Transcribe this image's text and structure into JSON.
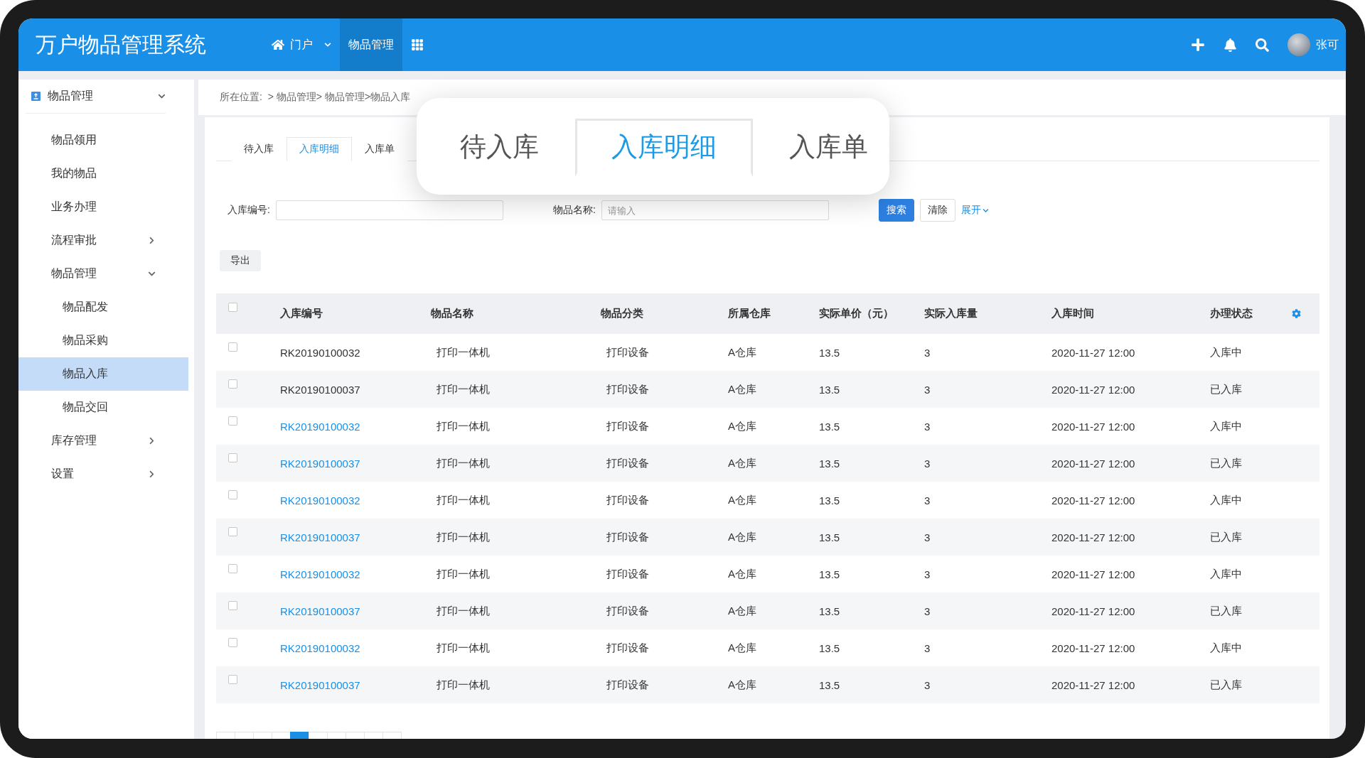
{
  "header": {
    "title": "万户物品管理系统",
    "nav": [
      {
        "kind": "home",
        "label": "门户",
        "selected": false
      },
      {
        "kind": "text",
        "label": "物品管理",
        "selected": true
      },
      {
        "kind": "apps",
        "selected": false
      }
    ],
    "user": {
      "name": "张可"
    }
  },
  "sidebar": {
    "module": {
      "label": "物品管理",
      "expanded": true
    },
    "items": [
      {
        "label": "物品领用",
        "selected": false
      },
      {
        "label": "我的物品",
        "selected": false
      },
      {
        "label": "业务办理",
        "selected": false
      },
      {
        "label": "流程审批",
        "selected": false,
        "expanded": false
      },
      {
        "label": "物品管理",
        "selected": false,
        "expanded": true,
        "children": [
          {
            "label": "物品配发",
            "selected": false
          },
          {
            "label": "物品采购",
            "selected": false
          },
          {
            "label": "物品入库",
            "selected": true
          },
          {
            "label": "物品交回",
            "selected": false
          }
        ]
      },
      {
        "label": "库存管理",
        "selected": false,
        "expanded": false
      },
      {
        "label": "设置",
        "selected": false,
        "expanded": false
      }
    ]
  },
  "breadcrumb": "所在位置:  > 物品管理> 物品管理>物品入库",
  "tabs": [
    {
      "label": "待入库",
      "selected": false
    },
    {
      "label": "入库明细",
      "selected": true
    },
    {
      "label": "入库单",
      "selected": false
    }
  ],
  "zoom_callout": {
    "tabs": [
      {
        "label": "待入库",
        "selected": false
      },
      {
        "label": "入库明细",
        "selected": true
      },
      {
        "label": "入库单",
        "selected": false
      }
    ]
  },
  "filters": [
    {
      "label": "入库编号:"
    },
    {
      "label": "物品名称:",
      "placeholder": "请输入"
    }
  ],
  "filter_buttons": {
    "search": "搜索",
    "clear": "清除",
    "expand": "展开"
  },
  "export_button": "导出",
  "table": {
    "all_checked": false,
    "columns": [
      "入库编号",
      "物品名称",
      "物品分类",
      "所属仓库",
      "实际单价（元）",
      "实际入库量",
      "入库时间",
      "办理状态"
    ],
    "rows": [
      {
        "checked": false,
        "linked": false,
        "cells": [
          "RK20190100032",
          "打印一体机",
          "打印设备",
          "A仓库",
          "13.5",
          "3",
          "2020-11-27 12:00",
          "入库中"
        ]
      },
      {
        "checked": false,
        "linked": false,
        "cells": [
          "RK20190100037",
          "打印一体机",
          "打印设备",
          "A仓库",
          "13.5",
          "3",
          "2020-11-27 12:00",
          "已入库"
        ]
      },
      {
        "checked": false,
        "linked": true,
        "cells": [
          "RK20190100032",
          "打印一体机",
          "打印设备",
          "A仓库",
          "13.5",
          "3",
          "2020-11-27 12:00",
          "入库中"
        ]
      },
      {
        "checked": false,
        "linked": true,
        "cells": [
          "RK20190100037",
          "打印一体机",
          "打印设备",
          "A仓库",
          "13.5",
          "3",
          "2020-11-27 12:00",
          "已入库"
        ]
      },
      {
        "checked": false,
        "linked": true,
        "cells": [
          "RK20190100032",
          "打印一体机",
          "打印设备",
          "A仓库",
          "13.5",
          "3",
          "2020-11-27 12:00",
          "入库中"
        ]
      },
      {
        "checked": false,
        "linked": true,
        "cells": [
          "RK20190100037",
          "打印一体机",
          "打印设备",
          "A仓库",
          "13.5",
          "3",
          "2020-11-27 12:00",
          "已入库"
        ]
      },
      {
        "checked": false,
        "linked": true,
        "cells": [
          "RK20190100032",
          "打印一体机",
          "打印设备",
          "A仓库",
          "13.5",
          "3",
          "2020-11-27 12:00",
          "入库中"
        ]
      },
      {
        "checked": false,
        "linked": true,
        "cells": [
          "RK20190100037",
          "打印一体机",
          "打印设备",
          "A仓库",
          "13.5",
          "3",
          "2020-11-27 12:00",
          "已入库"
        ]
      },
      {
        "checked": false,
        "linked": true,
        "cells": [
          "RK20190100032",
          "打印一体机",
          "打印设备",
          "A仓库",
          "13.5",
          "3",
          "2020-11-27 12:00",
          "入库中"
        ]
      },
      {
        "checked": false,
        "linked": true,
        "cells": [
          "RK20190100037",
          "打印一体机",
          "打印设备",
          "A仓库",
          "13.5",
          "3",
          "2020-11-27 12:00",
          "已入库"
        ]
      }
    ]
  },
  "pagination": {
    "pages": [
      {
        "selected": false
      },
      {
        "selected": false
      },
      {
        "selected": false
      },
      {
        "selected": false
      },
      {
        "selected": true
      },
      {
        "selected": false
      },
      {
        "selected": false
      },
      {
        "selected": false
      },
      {
        "selected": false
      },
      {
        "selected": false
      }
    ]
  }
}
